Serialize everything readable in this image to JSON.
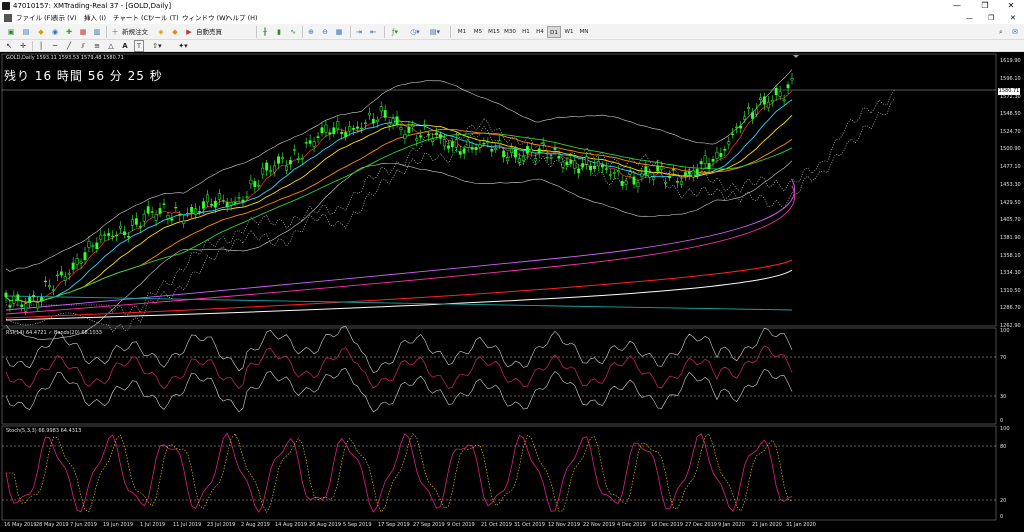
{
  "window": {
    "title": "47010157: XMTrading-Real 37 - [GOLD,Daily]",
    "controls": [
      "—",
      "❐",
      "✕"
    ]
  },
  "menu": {
    "items": [
      "ファイル (F)",
      "表示 (V)",
      "挿入 (I)",
      "チャート (C)",
      "ツール (T)",
      "ウィンドウ (W)",
      "ヘルプ (H)"
    ],
    "child_controls": [
      "—",
      "❐",
      "✕"
    ]
  },
  "toolbar": {
    "new_order_label": "新規注文",
    "auto_trade_label": "自動売買",
    "timeframes": [
      "M1",
      "M5",
      "M15",
      "M30",
      "H1",
      "H4",
      "D1",
      "W1",
      "MN"
    ],
    "active_timeframe": "D1"
  },
  "chart": {
    "symbol_info": "GOLD,Daily  1593.11 1593.53 1579.48 1580.71",
    "countdown": "残り 16 時間 56 分 25 秒",
    "current_price": "1580.71",
    "price_ticks": [
      "1619.90",
      "1596.10",
      "1572.30",
      "1548.50",
      "1524.70",
      "1500.90",
      "1477.10",
      "1453.30",
      "1429.50",
      "1405.70",
      "1381.90",
      "1358.10",
      "1334.30",
      "1310.50",
      "1286.70",
      "1262.90"
    ],
    "rsi_info": "RSI(14) 64.4721  ✓ Bands(20) 68.1033",
    "rsi_ticks": [
      "100",
      "70",
      "30",
      "0"
    ],
    "stoch_info": "Stoch(5,3,3) 66.9983 64.4313",
    "stoch_ticks": [
      "100",
      "80",
      "20",
      "0"
    ],
    "date_ticks": [
      "16 May 2019",
      "28 May 2019",
      "7 Jun 2019",
      "19 Jun 2019",
      "1 Jul 2019",
      "11 Jul 2019",
      "23 Jul 2019",
      "2 Aug 2019",
      "14 Aug 2019",
      "26 Aug 2019",
      "5 Sep 2019",
      "17 Sep 2019",
      "27 Sep 2019",
      "9 Oct 2019",
      "21 Oct 2019",
      "31 Oct 2019",
      "12 Nov 2019",
      "22 Nov 2019",
      "4 Dec 2019",
      "16 Dec 2019",
      "27 Dec 2019",
      "9 Jan 2020",
      "21 Jan 2020",
      "31 Jan 2020"
    ],
    "colors": {
      "bull_candle": "#33ff33",
      "bear_candle": "#000000",
      "ma_fast": "#ff3333",
      "ma_cyan": "#22d4ff",
      "ma_yellow": "#ffe000",
      "ma_orange": "#ff8c00",
      "ma_green": "#33cc33",
      "ma_magenta": "#ff33aa",
      "ma_violet": "#cc66ff",
      "ma_red": "#ff2020",
      "ma_white": "#ffffff",
      "ma_teal": "#1aa0a0",
      "bands": "#d0d0d0"
    }
  }
}
